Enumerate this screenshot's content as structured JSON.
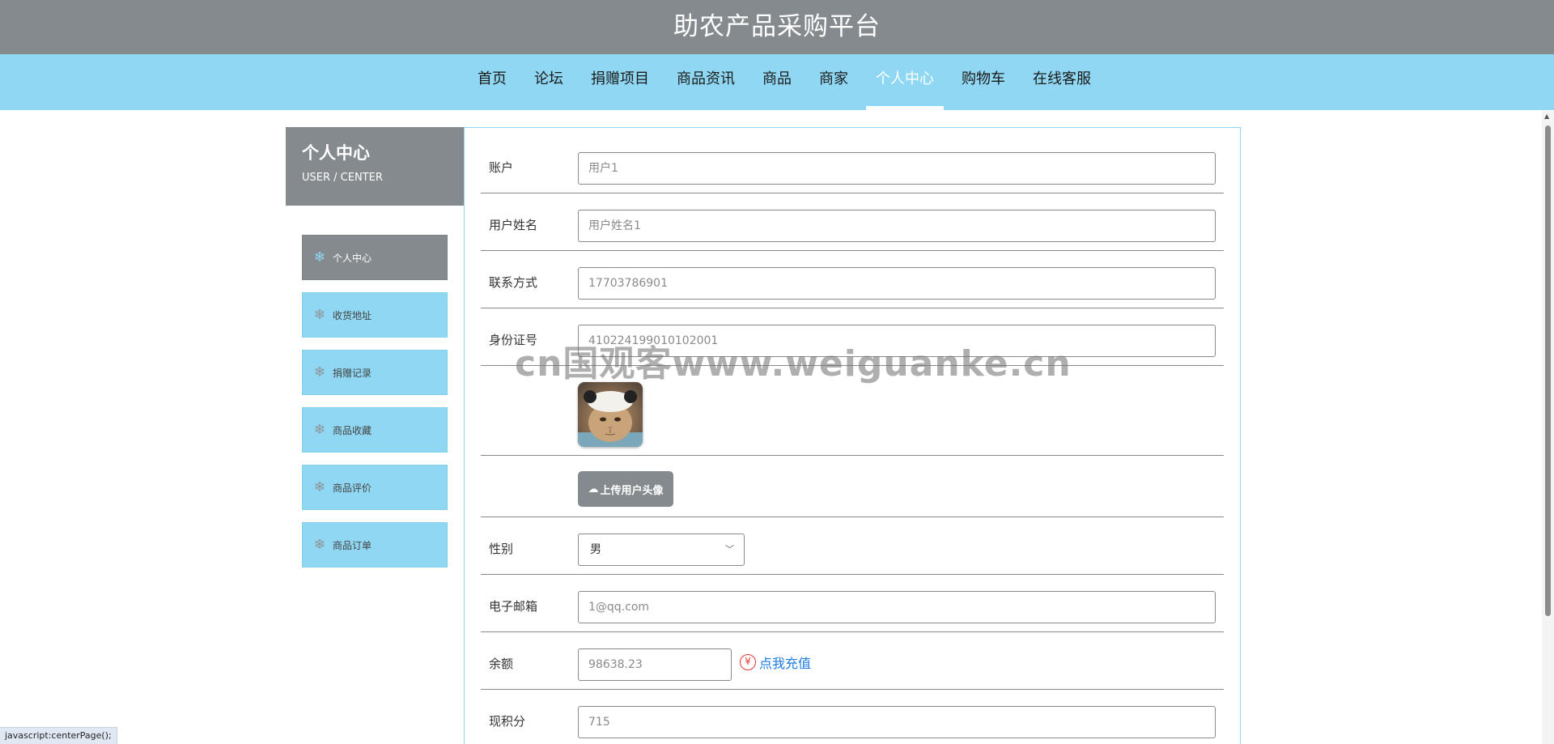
{
  "header": {
    "title": "助农产品采购平台"
  },
  "nav": {
    "items": [
      "首页",
      "论坛",
      "捐赠项目",
      "商品资讯",
      "商品",
      "商家",
      "个人中心",
      "购物车",
      "在线客服"
    ],
    "active": "个人中心"
  },
  "sidebar": {
    "title": "个人中心",
    "subtitle": "USER / CENTER",
    "items": [
      {
        "label": "个人中心",
        "icon": "snowflake-icon"
      },
      {
        "label": "收货地址",
        "icon": "snowflake-icon"
      },
      {
        "label": "捐赠记录",
        "icon": "snowflake-icon"
      },
      {
        "label": "商品收藏",
        "icon": "snowflake-icon"
      },
      {
        "label": "商品评价",
        "icon": "snowflake-icon"
      },
      {
        "label": "商品订单",
        "icon": "snowflake-icon"
      }
    ]
  },
  "form": {
    "account": {
      "label": "账户",
      "value": "用户1"
    },
    "username": {
      "label": "用户姓名",
      "value": "用户姓名1"
    },
    "phone": {
      "label": "联系方式",
      "value": "17703786901"
    },
    "idcard": {
      "label": "身份证号",
      "value": "410224199010102001"
    },
    "upload_label": "上传用户头像",
    "gender": {
      "label": "性别",
      "value": "男"
    },
    "email": {
      "label": "电子邮箱",
      "value": "1@qq.com"
    },
    "balance": {
      "label": "余额",
      "value": "98638.23",
      "recharge": "点我充值",
      "yen_symbol": "¥"
    },
    "points": {
      "label": "现积分",
      "value": "715"
    }
  },
  "watermark": "cn国观客www.weiguanke.cn",
  "status_bar": {
    "url": "javascript:centerPage();"
  },
  "colors": {
    "header_bg": "#848a8d",
    "nav_bg": "#8fd7f2",
    "link": "#1e7be0",
    "accent_red": "#e53935"
  }
}
